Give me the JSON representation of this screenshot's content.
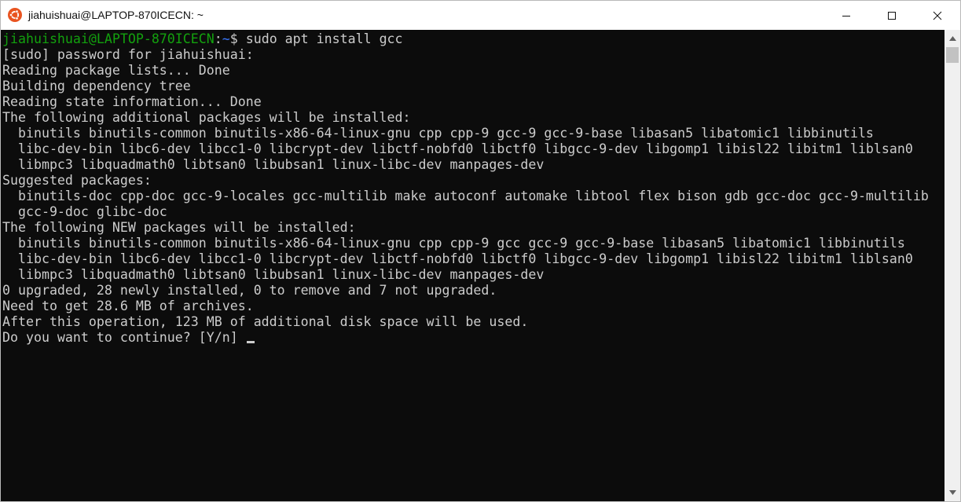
{
  "window": {
    "title": "jiahuishuai@LAPTOP-870ICECN: ~",
    "app_icon": "ubuntu-logo-icon",
    "buttons": {
      "minimize": "minimize-icon",
      "maximize": "maximize-icon",
      "close": "close-icon"
    }
  },
  "colors": {
    "background": "#0c0c0c",
    "text": "#cccccc",
    "prompt_user": "#13a10e",
    "prompt_path": "#3b78ff",
    "ubuntu_orange": "#e95420"
  },
  "terminal": {
    "prompt": {
      "user_host": "jiahuishuai@LAPTOP-870ICECN",
      "colon": ":",
      "path": "~",
      "command": "$ sudo apt install gcc"
    },
    "output": [
      "[sudo] password for jiahuishuai:",
      "Reading package lists... Done",
      "Building dependency tree",
      "Reading state information... Done",
      "The following additional packages will be installed:",
      "  binutils binutils-common binutils-x86-64-linux-gnu cpp cpp-9 gcc-9 gcc-9-base libasan5 libatomic1 libbinutils",
      "  libc-dev-bin libc6-dev libcc1-0 libcrypt-dev libctf-nobfd0 libctf0 libgcc-9-dev libgomp1 libisl22 libitm1 liblsan0",
      "  libmpc3 libquadmath0 libtsan0 libubsan1 linux-libc-dev manpages-dev",
      "Suggested packages:",
      "  binutils-doc cpp-doc gcc-9-locales gcc-multilib make autoconf automake libtool flex bison gdb gcc-doc gcc-9-multilib",
      "  gcc-9-doc glibc-doc",
      "The following NEW packages will be installed:",
      "  binutils binutils-common binutils-x86-64-linux-gnu cpp cpp-9 gcc gcc-9 gcc-9-base libasan5 libatomic1 libbinutils",
      "  libc-dev-bin libc6-dev libcc1-0 libcrypt-dev libctf-nobfd0 libctf0 libgcc-9-dev libgomp1 libisl22 libitm1 liblsan0",
      "  libmpc3 libquadmath0 libtsan0 libubsan1 linux-libc-dev manpages-dev",
      "0 upgraded, 28 newly installed, 0 to remove and 7 not upgraded.",
      "Need to get 28.6 MB of archives.",
      "After this operation, 123 MB of additional disk space will be used.",
      "Do you want to continue? [Y/n] "
    ]
  }
}
